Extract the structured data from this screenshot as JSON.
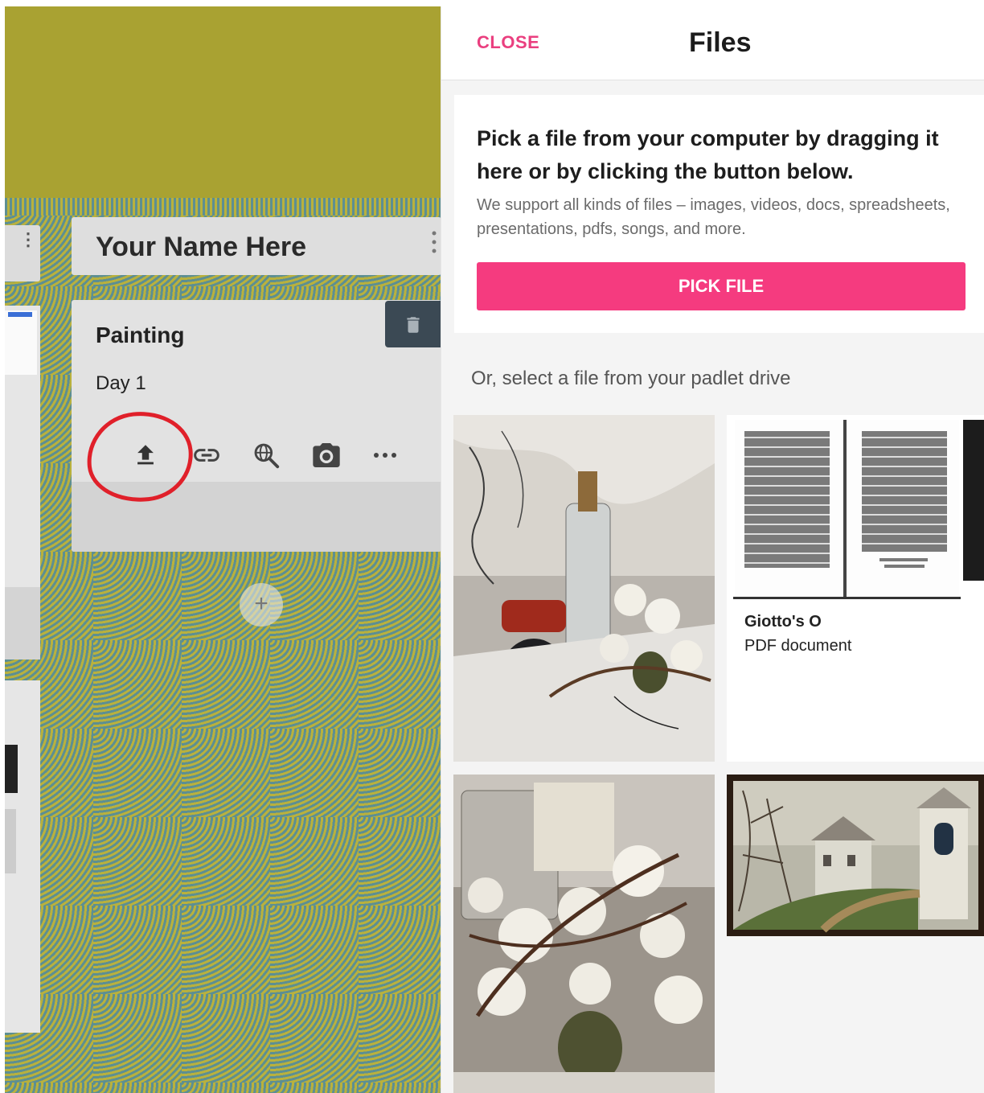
{
  "board": {
    "column_title": "Your Name Here",
    "post": {
      "title": "Painting",
      "body": "Day 1"
    },
    "attachment_icons": [
      "upload-icon",
      "link-icon",
      "web-search-icon",
      "camera-icon",
      "more-icon"
    ],
    "delete_icon": "trash-icon",
    "add_icon": "plus-icon",
    "colors": {
      "header_band": "#a9a232",
      "wallpaper_teal": "#5d8f92",
      "wallpaper_yellow": "#b9b13d",
      "annotation": "#e0202a"
    }
  },
  "panel": {
    "close_label": "CLOSE",
    "title": "Files",
    "pick_heading": "Pick a file from your computer by dragging it here or by clicking the button below.",
    "pick_subtext": "We support all kinds of files – images, videos, docs, spreadsheets, presentations, pdfs, songs, and more.",
    "pick_button": "PICK FILE",
    "drive_label": "Or, select a file from your padlet drive",
    "files": [
      {
        "kind": "image"
      },
      {
        "kind": "pdf",
        "name": "Giotto's O",
        "type": "PDF document"
      },
      {
        "kind": "image"
      },
      {
        "kind": "image"
      }
    ],
    "colors": {
      "accent": "#f53b7f",
      "close": "#ea3f7f"
    }
  }
}
